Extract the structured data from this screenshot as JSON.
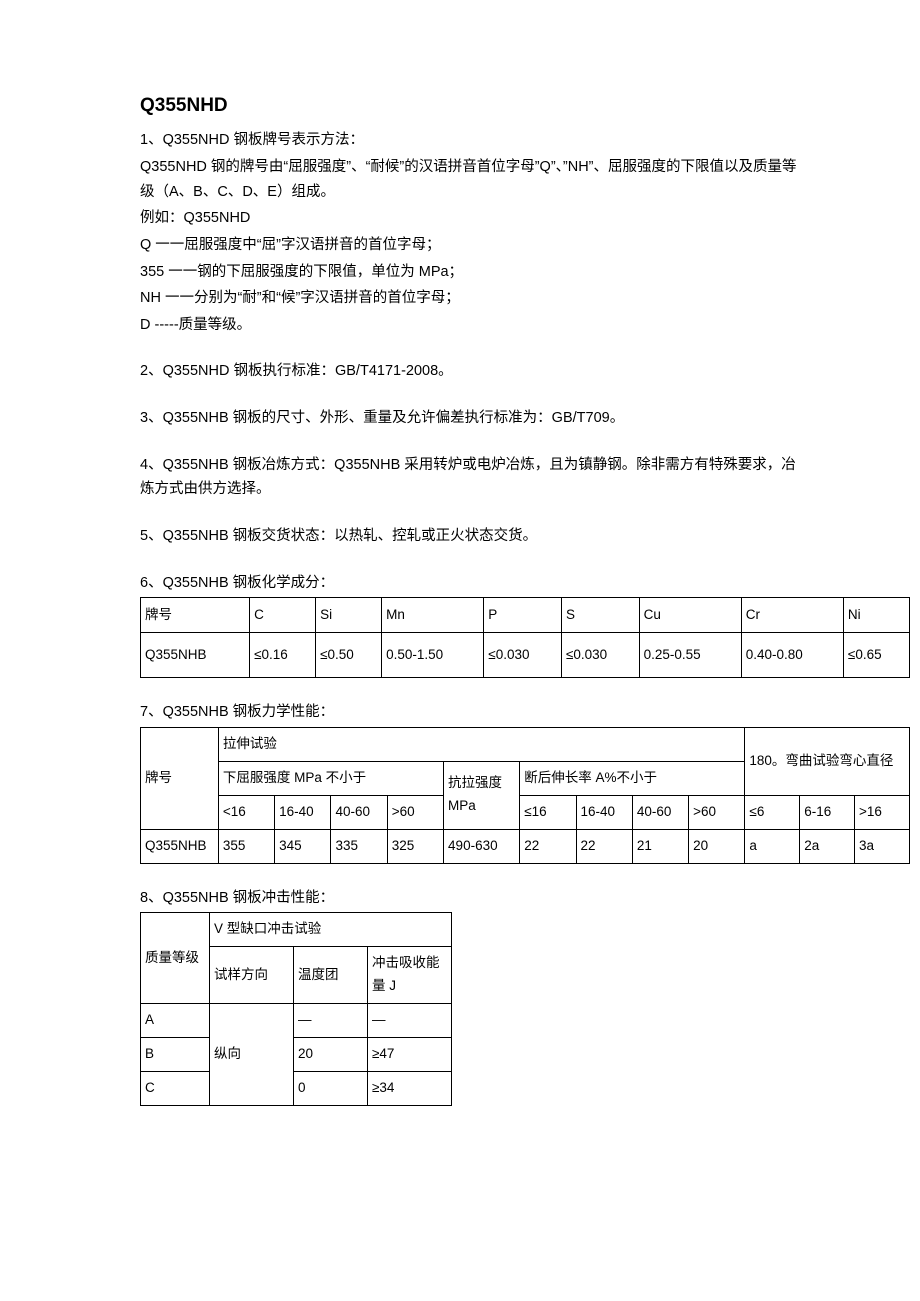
{
  "title": "Q355NHD",
  "sections": {
    "s1": {
      "head": "1、Q355NHD 钢板牌号表示方法：",
      "p1": "Q355NHD 钢的牌号由“屈服强度”、“耐候”的汉语拼音首位字母”Q”、”NH”、屈服强度的下限值以及质量等级（A、B、C、D、E）组成。",
      "p2": "例如：Q355NHD",
      "p3": "Q 一一屈服强度中“屈”字汉语拼音的首位字母；",
      "p4": "355 一一钢的下屈服强度的下限值，单位为 MPa；",
      "p5": "NH 一一分别为“耐”和“候”字汉语拼音的首位字母；",
      "p6": "D -----质量等级。"
    },
    "s2": "2、Q355NHD 钢板执行标准：GB/T4171-2008。",
    "s3": "3、Q355NHB 钢板的尺寸、外形、重量及允许偏差执行标准为：GB/T709。",
    "s4": "4、Q355NHB 钢板冶炼方式：Q355NHB 采用转炉或电炉冶炼，且为镇静钢。除非需方有特殊要求，冶炼方式由供方选择。",
    "s5": "5、Q355NHB 钢板交货状态：以热轧、控轧或正火状态交货。",
    "s6": {
      "head": "6、Q355NHB 钢板化学成分：",
      "table": {
        "h": [
          "牌号",
          "C",
          "Si",
          "Mn",
          "P",
          "S",
          "Cu",
          "Cr",
          "Ni"
        ],
        "r": [
          "Q355NHB",
          "≤0.16",
          "≤0.50",
          "0.50-1.50",
          "≤0.030",
          "≤0.030",
          "0.25-0.55",
          "0.40-0.80",
          "≤0.65"
        ]
      }
    },
    "s7": {
      "head": "7、Q355NHB 钢板力学性能：",
      "tbl": {
        "r1": {
          "c0": "牌号",
          "c1": "拉伸试验",
          "c2": "180。弯曲试验弯心直径"
        },
        "r2": {
          "c1": "下屈服强度 MPa 不小于",
          "c2": "抗拉强度 MPa",
          "c3": "断后伸长率 A%不小于"
        },
        "r3": [
          "<16",
          "16-40",
          "40-60",
          ">60",
          "≤16",
          "16-40",
          "40-60",
          ">60",
          "≤6",
          "6-16",
          ">16"
        ],
        "r4": [
          "Q355NHB",
          "355",
          "345",
          "335",
          "325",
          "490-630",
          "22",
          "22",
          "21",
          "20",
          "a",
          "2a",
          "3a"
        ]
      }
    },
    "s8": {
      "head": "8、Q355NHB 钢板冲击性能：",
      "tbl": {
        "r1": {
          "c0": "质量等级",
          "c1": "V 型缺口冲击试验"
        },
        "r2": [
          "试样方向",
          "温度团",
          "冲击吸收能量 J"
        ],
        "rA": [
          "A",
          "—",
          "—"
        ],
        "rB": [
          "B",
          "纵向",
          "20",
          "≥47"
        ],
        "rC": [
          "C",
          "0",
          "≥34"
        ]
      }
    }
  }
}
